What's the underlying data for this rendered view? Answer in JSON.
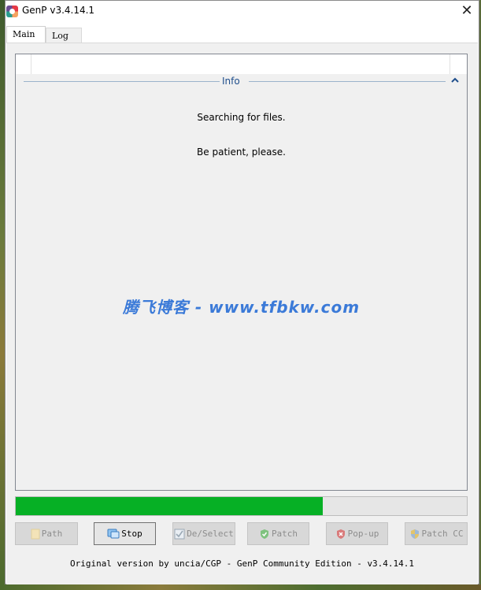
{
  "window": {
    "title": "GenP v3.4.14.1",
    "close_glyph": "✕"
  },
  "tabs": [
    {
      "label": "Main",
      "active": true
    },
    {
      "label": "Log",
      "active": false
    }
  ],
  "info": {
    "label": "Info",
    "messages": [
      "Searching for files.",
      "Be patient, please."
    ]
  },
  "watermark": "腾飞博客 - www.tfbkw.com",
  "progress": {
    "value": 0.68,
    "color": "#06b025"
  },
  "buttons": [
    {
      "label": "Path",
      "icon": "folder-icon",
      "enabled": false
    },
    {
      "label": "Stop",
      "icon": "stop-chat-icon",
      "enabled": true
    },
    {
      "label": "De/Select",
      "icon": "checkbox-icon",
      "enabled": false
    },
    {
      "label": "Patch",
      "icon": "shield-check-icon",
      "enabled": false
    },
    {
      "label": "Pop-up",
      "icon": "shield-x-icon",
      "enabled": false
    },
    {
      "label": "Patch CC",
      "icon": "uac-shield-icon",
      "enabled": false
    }
  ],
  "footer": "Original version by uncia/CGP - GenP Community Edition - v3.4.14.1",
  "colors": {
    "accent": "#1f4e8c",
    "progress": "#06b025",
    "watermark": "#3b7ad8"
  }
}
